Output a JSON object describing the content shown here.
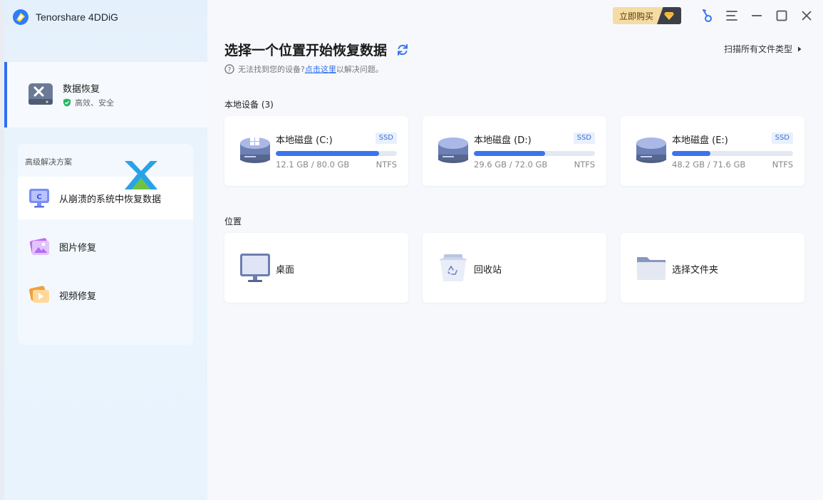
{
  "app": {
    "title": "Tenorshare 4DDiG"
  },
  "sidebar": {
    "active": {
      "label": "数据恢复",
      "subtitle": "高效、安全"
    },
    "advanced": {
      "title": "高级解决方案",
      "items": [
        {
          "label": "从崩溃的系统中恢复数据"
        },
        {
          "label": "图片修复"
        },
        {
          "label": "视频修复"
        }
      ]
    }
  },
  "topbar": {
    "buy_label": "立即购买"
  },
  "main": {
    "heading": "选择一个位置开始恢复数据",
    "scan_all": "扫描所有文件类型",
    "hint_prefix": "无法找到您的设备?",
    "hint_link": "点击这里",
    "hint_suffix": "以解决问题。"
  },
  "local_devices": {
    "label": "本地设备 (3)",
    "disks": [
      {
        "name": "本地磁盘 (C:)",
        "type": "SSD",
        "usage": "12.1 GB / 80.0 GB",
        "fs": "NTFS",
        "fill": 0.85
      },
      {
        "name": "本地磁盘 (D:)",
        "type": "SSD",
        "usage": "29.6 GB / 72.0 GB",
        "fs": "NTFS",
        "fill": 0.59
      },
      {
        "name": "本地磁盘 (E:)",
        "type": "SSD",
        "usage": "48.2 GB / 71.6 GB",
        "fs": "NTFS",
        "fill": 0.32
      }
    ]
  },
  "locations": {
    "label": "位置",
    "items": [
      {
        "label": "桌面"
      },
      {
        "label": "回收站"
      },
      {
        "label": "选择文件夹"
      }
    ]
  },
  "colors": {
    "accent": "#2f6ff5",
    "progress": "#3a74f0",
    "buy_bg": "#f4dca4"
  }
}
